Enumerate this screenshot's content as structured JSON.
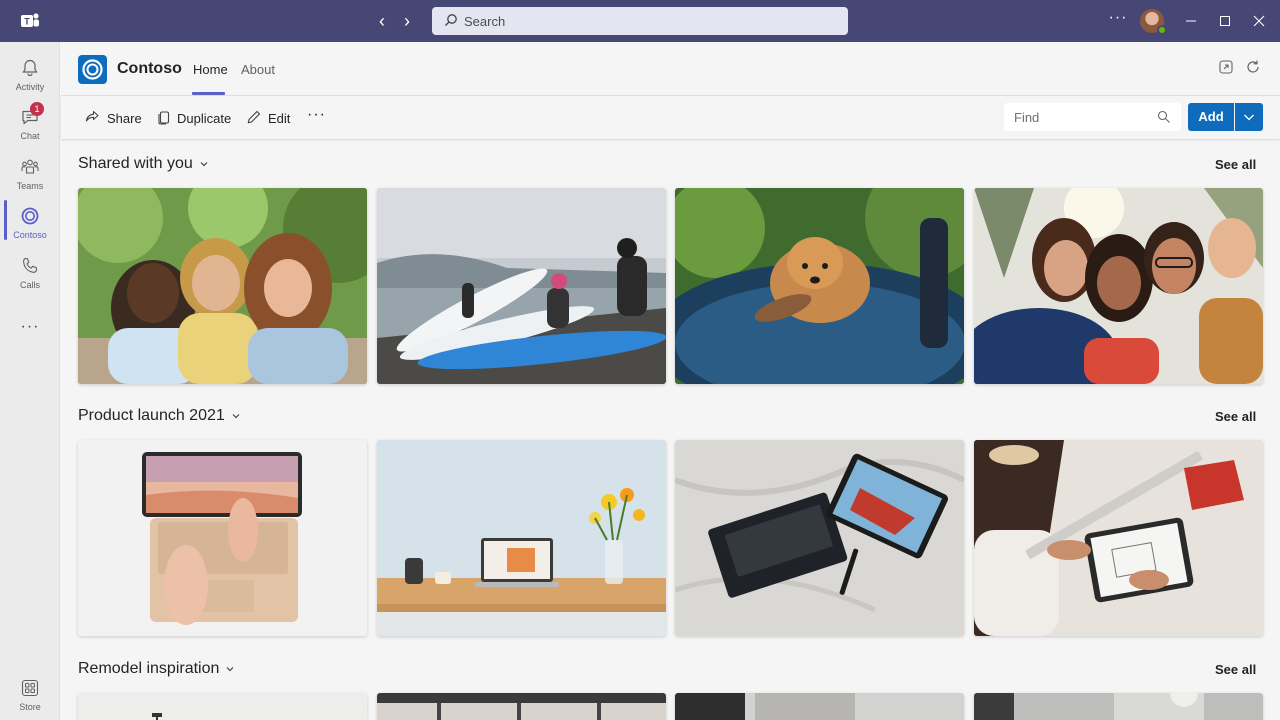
{
  "titlebar": {
    "search_placeholder": "Search",
    "more_label": "···"
  },
  "rail": {
    "items": [
      {
        "label": "Activity",
        "icon": "bell-icon"
      },
      {
        "label": "Chat",
        "icon": "chat-icon",
        "badge": "1"
      },
      {
        "label": "Teams",
        "icon": "teams-icon"
      },
      {
        "label": "Contoso",
        "icon": "contoso-icon",
        "active": true
      },
      {
        "label": "Calls",
        "icon": "phone-icon"
      }
    ],
    "more_label": "···",
    "store_label": "Store"
  },
  "app": {
    "name": "Contoso",
    "tabs": [
      "Home",
      "About"
    ],
    "active_tab": "Home",
    "brand_color": "#0f6cbd",
    "accent_color": "#5b5fc7"
  },
  "toolbar": {
    "share_label": "Share",
    "duplicate_label": "Duplicate",
    "edit_label": "Edit",
    "more_label": "···",
    "find_placeholder": "Find",
    "add_label": "Add"
  },
  "sections": [
    {
      "title": "Shared with you",
      "see_all": "See all",
      "cards": [
        "friends-selfie-photo",
        "paddleboards-beach-photo",
        "dog-trampoline-photo",
        "group-selfie-photo"
      ]
    },
    {
      "title": "Product launch 2021",
      "see_all": "See all",
      "cards": [
        "laptop-typing-photo",
        "laptop-desk-flowers-photo",
        "tablet-keyboard-bed-photo",
        "tablet-drawing-desk-photo"
      ]
    },
    {
      "title": "Remodel inspiration",
      "see_all": "See all",
      "cards": [
        "interior-photo-1",
        "interior-photo-2",
        "interior-photo-3",
        "interior-photo-4"
      ]
    }
  ]
}
